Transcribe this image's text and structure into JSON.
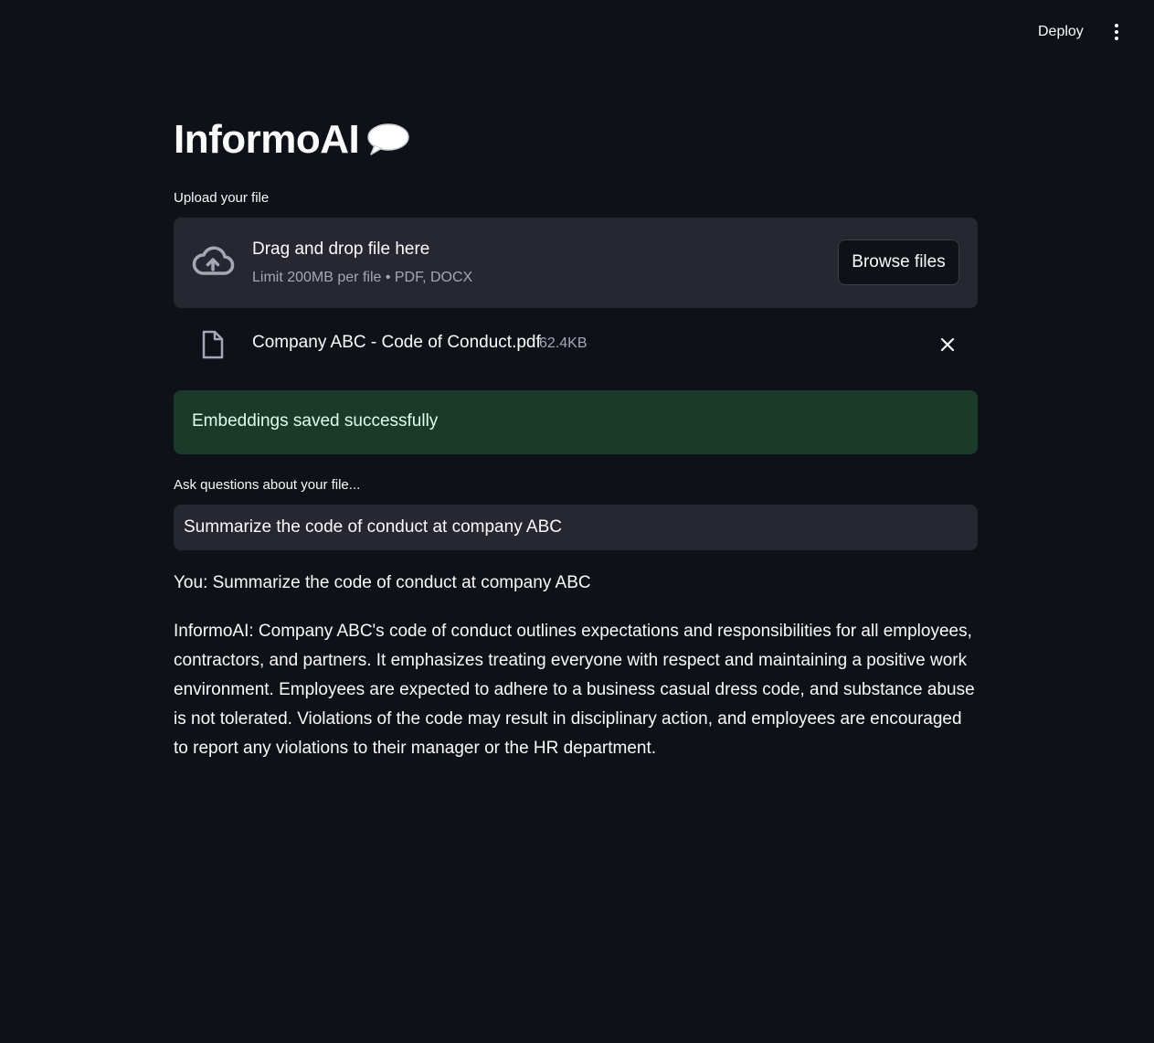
{
  "topbar": {
    "deploy_label": "Deploy",
    "menu_icon": "more-vertical-icon"
  },
  "header": {
    "title": "InformoAI",
    "title_icon": "speech-bubble-icon"
  },
  "uploader": {
    "label": "Upload your file",
    "dropzone_title": "Drag and drop file here",
    "dropzone_subtitle": "Limit 200MB per file • PDF, DOCX",
    "browse_label": "Browse files",
    "upload_icon": "cloud-upload-icon"
  },
  "uploaded_file": {
    "name": "Company ABC - Code of Conduct.pdf",
    "size": "62.4KB",
    "file_icon": "document-icon",
    "remove_icon": "close-icon"
  },
  "status": {
    "message": "Embeddings saved successfully",
    "color": "#1b3a2a"
  },
  "question": {
    "label": "Ask questions about your file...",
    "value": "Summarize the code of conduct at company ABC"
  },
  "conversation": {
    "user_message": "You: Summarize the code of conduct at company ABC",
    "assistant_message": "InformoAI: Company ABC's code of conduct outlines expectations and responsibilities for all employees, contractors, and partners. It emphasizes treating everyone with respect and maintaining a positive work environment. Employees are expected to adhere to a business casual dress code, and substance abuse is not tolerated. Violations of the code may result in disciplinary action, and employees are encouraged to report any violations to their manager or the HR department."
  },
  "colors": {
    "background": "#0e1117",
    "surface": "#262730",
    "success_bg": "#1b3a2a",
    "text": "#fafafa",
    "muted": "#a3a8b8"
  }
}
